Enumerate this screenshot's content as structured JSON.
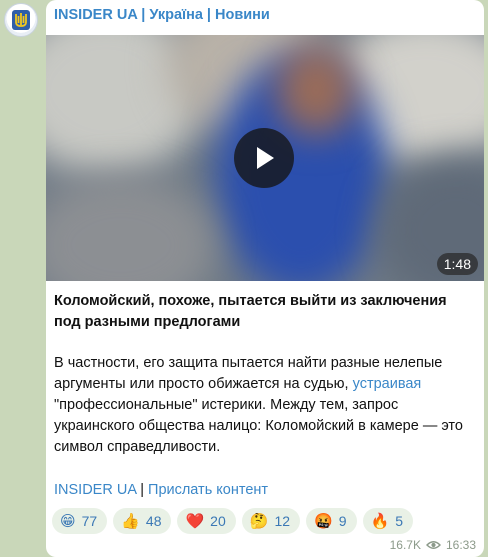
{
  "channel": {
    "name": "INSIDER UA | Україна | Новини"
  },
  "video": {
    "duration": "1:48"
  },
  "post": {
    "title": "Коломойский, похоже, пытается выйти из заключения под разными предлогами",
    "body_1": "В частности, его защита пытается найти разные нелепые аргументы или просто обижается на судью, ",
    "body_link": "устраивая",
    "body_2": " \"профессиональные\" истерики. Между тем, запрос украинского общества налицо: Коломойский в камере — это символ справедливости.",
    "footer_link_1": "INSIDER UA",
    "footer_sep": " | ",
    "footer_link_2": "Прислать контент"
  },
  "reactions": [
    {
      "emoji": "😁",
      "icon": "grinning-face-icon",
      "count": "77"
    },
    {
      "emoji": "👍",
      "icon": "thumbs-up-icon",
      "count": "48"
    },
    {
      "emoji": "❤️",
      "icon": "red-heart-icon",
      "count": "20"
    },
    {
      "emoji": "🤔",
      "icon": "thinking-face-icon",
      "count": "12"
    },
    {
      "emoji": "🤬",
      "icon": "angry-face-icon",
      "count": "9"
    },
    {
      "emoji": "🔥",
      "icon": "fire-icon",
      "count": "5"
    }
  ],
  "meta": {
    "views": "16.7K",
    "time": "16:33"
  },
  "colors": {
    "accent": "#3a87c8",
    "background": "#c9d7b9",
    "bubble": "#ffffff"
  }
}
